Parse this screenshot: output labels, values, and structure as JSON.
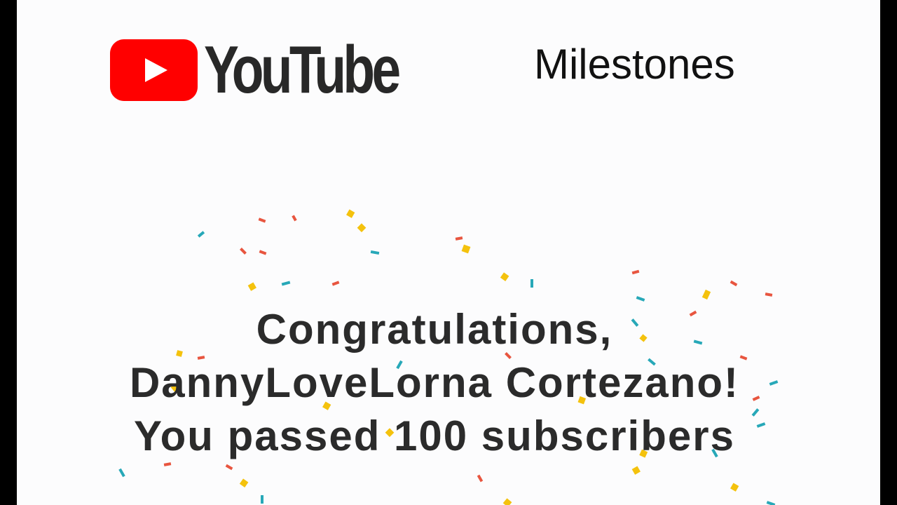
{
  "brand": {
    "name": "YouTube",
    "icon": "youtube-play-icon",
    "icon_color": "#FF0000"
  },
  "header": {
    "title": "Milestones"
  },
  "message": {
    "line1": "Congratulations,",
    "line2": "DannyLoveLorna Cortezano!",
    "line3": "You passed 100 subscribers"
  },
  "decoration": {
    "confetti_colors": [
      "#F4C20D",
      "#E8553F",
      "#27A8B8"
    ]
  }
}
